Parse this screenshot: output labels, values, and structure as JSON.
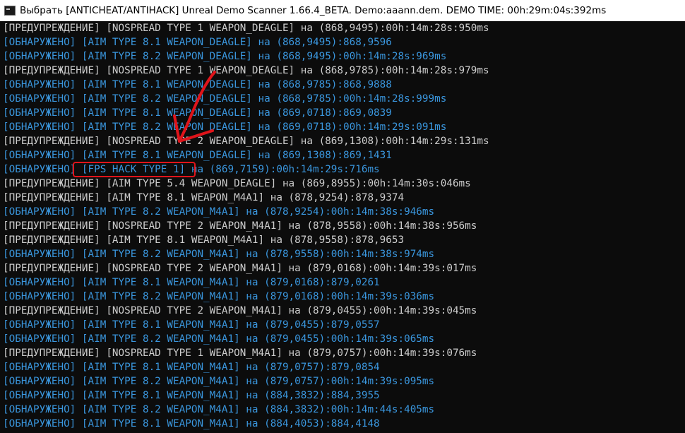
{
  "window": {
    "title": "Выбрать [ANTICHEAT/ANTIHACK] Unreal Demo Scanner 1.66.4_BETA. Demo:aaann.dem. DEMO TIME: 00h:29m:04s:392ms"
  },
  "colors": {
    "background": "#0c0c0c",
    "warning_text": "#cccccc",
    "detection_text": "#3a96dd",
    "annotation_red": "#e0141a"
  },
  "icons": {
    "app": "console-app-icon"
  },
  "annotation": {
    "highlight_text": "[FPS HACK TYPE 1]"
  },
  "lines": [
    {
      "kind": "warn",
      "text": "[ПРЕДУПРЕЖДЕНИЕ] [NOSPREAD TYPE 1 WEAPON_DEAGLE] на (868,9495):00h:14m:28s:950ms"
    },
    {
      "kind": "detect",
      "text": "[ОБНАРУЖЕНО] [AIM TYPE 8.1 WEAPON_DEAGLE] на (868,9495):868,9596"
    },
    {
      "kind": "detect",
      "text": "[ОБНАРУЖЕНО] [AIM TYPE 8.2 WEAPON_DEAGLE] на (868,9495):00h:14m:28s:969ms"
    },
    {
      "kind": "warn",
      "text": "[ПРЕДУПРЕЖДЕНИЕ] [NOSPREAD TYPE 1 WEAPON_DEAGLE] на (868,9785):00h:14m:28s:979ms"
    },
    {
      "kind": "detect",
      "text": "[ОБНАРУЖЕНО] [AIM TYPE 8.1 WEAPON_DEAGLE] на (868,9785):868,9888"
    },
    {
      "kind": "detect",
      "text": "[ОБНАРУЖЕНО] [AIM TYPE 8.2 WEAPON_DEAGLE] на (868,9785):00h:14m:28s:999ms"
    },
    {
      "kind": "detect",
      "text": "[ОБНАРУЖЕНО] [AIM TYPE 8.1 WEAPON_DEAGLE] на (869,0718):869,0839"
    },
    {
      "kind": "detect",
      "text": "[ОБНАРУЖЕНО] [AIM TYPE 8.2 WEAPON_DEAGLE] на (869,0718):00h:14m:29s:091ms"
    },
    {
      "kind": "warn",
      "text": "[ПРЕДУПРЕЖДЕНИЕ] [NOSPREAD TYPE 2 WEAPON_DEAGLE] на (869,1308):00h:14m:29s:131ms"
    },
    {
      "kind": "detect",
      "text": "[ОБНАРУЖЕНО] [AIM TYPE 8.1 WEAPON_DEAGLE] на (869,1308):869,1431"
    },
    {
      "kind": "detect",
      "text": "[ОБНАРУЖЕНО] [FPS HACK TYPE 1] на (869,7159):00h:14m:29s:716ms"
    },
    {
      "kind": "warn",
      "text": "[ПРЕДУПРЕЖДЕНИЕ] [AIM TYPE 5.4 WEAPON_DEAGLE] на (869,8955):00h:14m:30s:046ms"
    },
    {
      "kind": "warn",
      "text": "[ПРЕДУПРЕЖДЕНИЕ] [AIM TYPE 8.1 WEAPON_M4A1] на (878,9254):878,9374"
    },
    {
      "kind": "detect",
      "text": "[ОБНАРУЖЕНО] [AIM TYPE 8.2 WEAPON_M4A1] на (878,9254):00h:14m:38s:946ms"
    },
    {
      "kind": "warn",
      "text": "[ПРЕДУПРЕЖДЕНИЕ] [NOSPREAD TYPE 2 WEAPON_M4A1] на (878,9558):00h:14m:38s:956ms"
    },
    {
      "kind": "warn",
      "text": "[ПРЕДУПРЕЖДЕНИЕ] [AIM TYPE 8.1 WEAPON_M4A1] на (878,9558):878,9653"
    },
    {
      "kind": "detect",
      "text": "[ОБНАРУЖЕНО] [AIM TYPE 8.2 WEAPON_M4A1] на (878,9558):00h:14m:38s:974ms"
    },
    {
      "kind": "warn",
      "text": "[ПРЕДУПРЕЖДЕНИЕ] [NOSPREAD TYPE 2 WEAPON_M4A1] на (879,0168):00h:14m:39s:017ms"
    },
    {
      "kind": "detect",
      "text": "[ОБНАРУЖЕНО] [AIM TYPE 8.1 WEAPON_M4A1] на (879,0168):879,0261"
    },
    {
      "kind": "detect",
      "text": "[ОБНАРУЖЕНО] [AIM TYPE 8.2 WEAPON_M4A1] на (879,0168):00h:14m:39s:036ms"
    },
    {
      "kind": "warn",
      "text": "[ПРЕДУПРЕЖДЕНИЕ] [NOSPREAD TYPE 2 WEAPON_M4A1] на (879,0455):00h:14m:39s:045ms"
    },
    {
      "kind": "detect",
      "text": "[ОБНАРУЖЕНО] [AIM TYPE 8.1 WEAPON_M4A1] на (879,0455):879,0557"
    },
    {
      "kind": "detect",
      "text": "[ОБНАРУЖЕНО] [AIM TYPE 8.2 WEAPON_M4A1] на (879,0455):00h:14m:39s:065ms"
    },
    {
      "kind": "warn",
      "text": "[ПРЕДУПРЕЖДЕНИЕ] [NOSPREAD TYPE 1 WEAPON_M4A1] на (879,0757):00h:14m:39s:076ms"
    },
    {
      "kind": "detect",
      "text": "[ОБНАРУЖЕНО] [AIM TYPE 8.1 WEAPON_M4A1] на (879,0757):879,0854"
    },
    {
      "kind": "detect",
      "text": "[ОБНАРУЖЕНО] [AIM TYPE 8.2 WEAPON_M4A1] на (879,0757):00h:14m:39s:095ms"
    },
    {
      "kind": "detect",
      "text": "[ОБНАРУЖЕНО] [AIM TYPE 8.1 WEAPON_M4A1] на (884,3832):884,3955"
    },
    {
      "kind": "detect",
      "text": "[ОБНАРУЖЕНО] [AIM TYPE 8.2 WEAPON_M4A1] на (884,3832):00h:14m:44s:405ms"
    },
    {
      "kind": "detect",
      "text": "[ОБНАРУЖЕНО] [AIM TYPE 8.1 WEAPON_M4A1] на (884,4053):884,4148"
    }
  ]
}
